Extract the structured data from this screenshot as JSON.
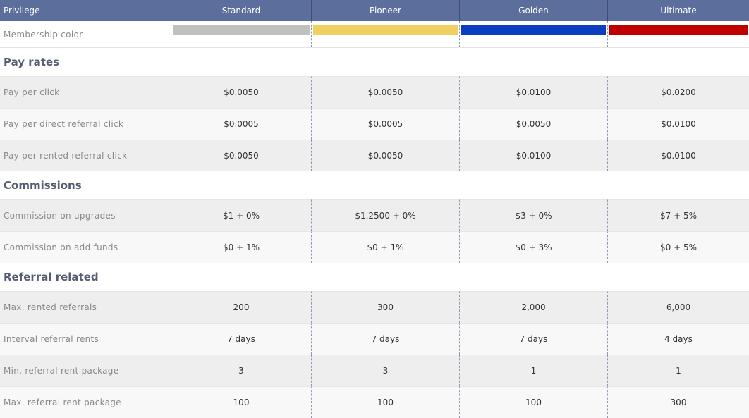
{
  "header": {
    "privilege_label": "Privilege",
    "tiers": [
      "Standard",
      "Pioneer",
      "Golden",
      "Ultimate"
    ]
  },
  "membership_color": {
    "label": "Membership  color",
    "colors": [
      "#c0c0c0",
      "#f0d060",
      "#0b3fc0",
      "#c00000"
    ]
  },
  "sections": {
    "pay_rates": {
      "title": "Pay rates",
      "rows": [
        {
          "label": "Pay per click",
          "values": [
            "$0.0050",
            "$0.0050",
            "$0.0100",
            "$0.0200"
          ]
        },
        {
          "label": "Pay per direct  referral click",
          "values": [
            "$0.0005",
            "$0.0005",
            "$0.0050",
            "$0.0100"
          ]
        },
        {
          "label": "Pay per rented  referral click",
          "values": [
            "$0.0050",
            "$0.0050",
            "$0.0100",
            "$0.0100"
          ]
        }
      ]
    },
    "commissions": {
      "title": "Commissions",
      "rows": [
        {
          "label": "Commission  on upgrades",
          "values": [
            "$1 + 0%",
            "$1.2500 + 0%",
            "$3 + 0%",
            "$7 + 5%"
          ]
        },
        {
          "label": "Commission  on add funds",
          "values": [
            "$0 + 1%",
            "$0 + 1%",
            "$0 + 3%",
            "$0 + 5%"
          ]
        }
      ]
    },
    "referral_related": {
      "title": "Referral related",
      "rows": [
        {
          "label": "Max. rented  referrals",
          "values": [
            "200",
            "300",
            "2,000",
            "6,000"
          ]
        },
        {
          "label": "Interval  referral rents",
          "values": [
            "7 days",
            "7 days",
            "7 days",
            "4 days"
          ]
        },
        {
          "label": "Min.  referral rent package",
          "values": [
            "3",
            "3",
            "1",
            "1"
          ]
        },
        {
          "label": "Max. referral rent package",
          "values": [
            "100",
            "100",
            "100",
            "300"
          ]
        }
      ]
    }
  }
}
